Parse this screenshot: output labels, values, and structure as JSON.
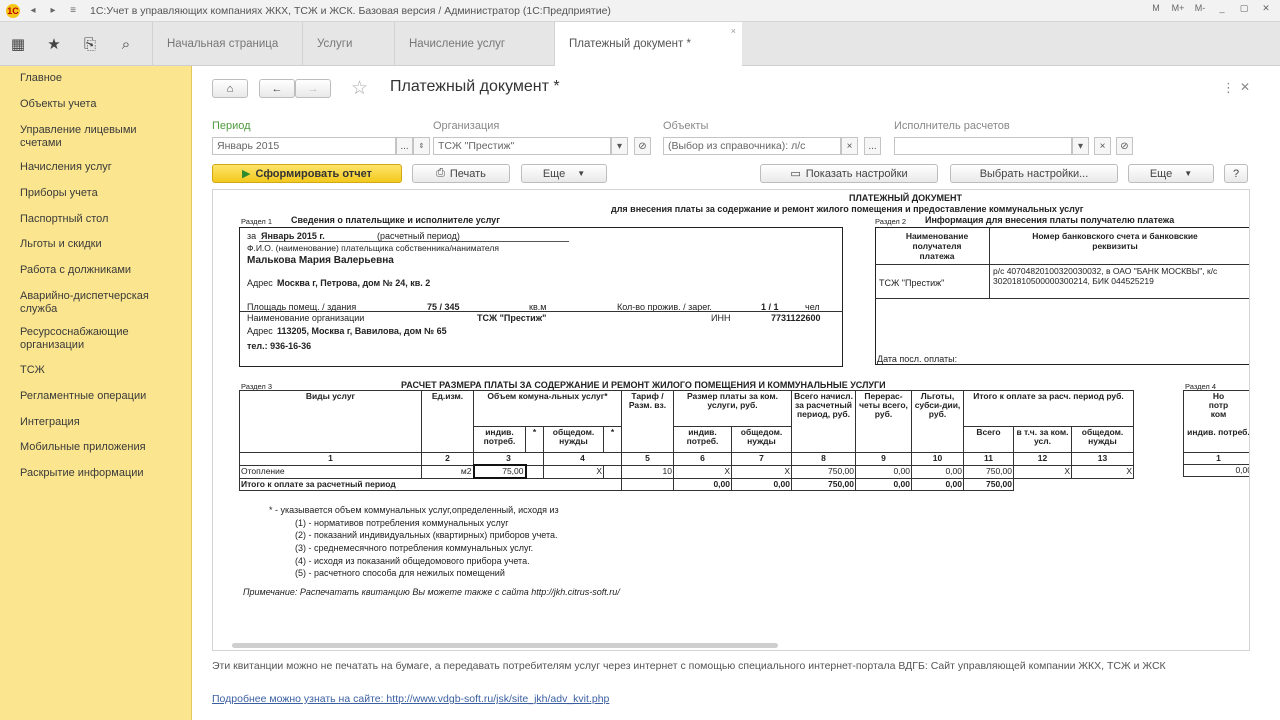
{
  "window": {
    "title": "1С:Учет в управляющих компаниях ЖКХ, ТСЖ и ЖСК. Базовая версия / Администратор  (1С:Предприятие)",
    "right_icons": [
      "M",
      "M+",
      "M-",
      "_",
      "▢",
      "✕"
    ]
  },
  "toolbar_icons": [
    "apps-icon",
    "star-icon",
    "history-icon",
    "search-icon"
  ],
  "tabs": [
    {
      "label": "Начальная страница"
    },
    {
      "label": "Услуги"
    },
    {
      "label": "Начисление услуг"
    },
    {
      "label": "Платежный документ *",
      "close": "×"
    }
  ],
  "sidebar": {
    "items": [
      "Главное",
      "Объекты учета",
      "Управление лицевыми счетами",
      "Начисления услуг",
      "Приборы учета",
      "Паспортный стол",
      "Льготы и скидки",
      "Работа с должниками",
      "Аварийно-диспетчерская служба",
      "Ресурсоснабжающие организации",
      "ТСЖ",
      "Регламентные операции",
      "Интеграция",
      "Мобильные приложения",
      "Раскрытие информации"
    ]
  },
  "form": {
    "title": "Платежный документ *",
    "nav": {
      "home": "⌂",
      "back": "←",
      "forward": "→",
      "star": "☆"
    },
    "corner_icons": [
      "⋮",
      "✕"
    ],
    "period_label": "Период",
    "period_value": "Январь 2015",
    "org_label": "Организация",
    "org_value": "ТСЖ \"Престиж\"",
    "objects_label": "Объекты",
    "objects_value": "(Выбор из справочника): л/с",
    "executor_label": "Исполнитель расчетов",
    "executor_value": "",
    "buttons": {
      "generate": "Сформировать отчет",
      "print": "Печать",
      "more": "Еще",
      "show_settings": "Показать настройки",
      "choose_settings": "Выбрать настройки...",
      "more2": "Еще",
      "help": "?"
    }
  },
  "report": {
    "doc_title": "ПЛАТЕЖНЫЙ ДОКУМЕНТ",
    "doc_subtitle": "для внесения платы за содержание и ремонт жилого помещения и предоставление коммунальных услуг",
    "section1_label": "Раздел 1",
    "section1_title": "Сведения о плательщике и исполнителе услуг",
    "section2_label": "Раздел 2",
    "section2_title": "Информация для внесения платы получателю платежа",
    "for_label": "за",
    "for_period": "Январь 2015 г.",
    "settlement_period": "(расчетный период)",
    "fio_caption": "Ф.И.О. (наименование) плательщика собственника/нанимателя",
    "payer_name": "Малькова Мария Валерьевна",
    "address_label": "Адрес",
    "address_value": "Москва г, Петрова, дом № 24, кв. 2",
    "area_label": "Площадь помещ. / здания",
    "area_value": "75 / 345",
    "area_unit": "кв.м",
    "residents_label": "Кол-во прожив. / зарег.",
    "residents_value": "1 / 1",
    "residents_unit": "чел",
    "org_name_label": "Наименование организации",
    "org_name_value": "ТСЖ \"Престиж\"",
    "inn_label": "ИНН",
    "inn_value": "7731122600",
    "org_address_label": "Адрес",
    "org_address_value": "113205, Москва г, Вавилова, дом № 65",
    "phone_value": "тел.: 936-16-36",
    "recipient_head": "Наименование получателя платежа",
    "bank_head": "Номер банковского счета и банковские реквизиты",
    "recipient_value": "ТСЖ \"Престиж\"",
    "bank_value": "р/с 40704820100320030032, в ОАО \"БАНК МОСКВЫ\", к/с 30201810500000300214, БИК 044525219",
    "last_payment_label": "Дата посл. оплаты:",
    "section3_label": "Раздел 3",
    "section3_title": "РАСЧЕТ РАЗМЕРА ПЛАТЫ ЗА СОДЕРЖАНИЕ И РЕМОНТ ЖИЛОГО ПОМЕЩЕНИЯ И КОММУНАЛЬНЫЕ УСЛУГИ",
    "section4_label": "Раздел 4",
    "table": {
      "h_service": "Виды услуг",
      "h_unit": "Ед.изм.",
      "h_volume": "Объем комуна-льных услуг*",
      "h_tariff": "Тариф / Разм. вз.",
      "h_size": "Размер платы за ком. услуги, руб.",
      "h_total_accrued": "Всего начисл. за расчетный период, руб.",
      "h_recalc": "Перерас-четы всего, руб.",
      "h_benefits": "Льготы, субси-дии, руб.",
      "h_total_pay": "Итого к оплате за расч. период руб.",
      "h_indiv": "индив. потреб.",
      "h_star": "*",
      "h_common": "общедом. нужды",
      "h_total": "Всего",
      "h_incl": "в т.ч. за ком. усл.",
      "h_right_top": "Но",
      "h_right_2": "потр",
      "h_right_3": "ком",
      "col_numbers": [
        "1",
        "2",
        "3",
        "4",
        "5",
        "6",
        "7",
        "8",
        "9",
        "10",
        "11",
        "12",
        "13",
        "1"
      ],
      "row": {
        "service": "Отопление",
        "unit": "м2",
        "volume": "75,00",
        "x": "X",
        "tariff": "10",
        "accrued": "750,00",
        "recalc": "0,00",
        "benefits": "0,00",
        "total": "750,00",
        "right": "0,00"
      },
      "total_row": {
        "label": "Итого к оплате за расчетный период",
        "v1": "0,00",
        "v2": "0,00",
        "v3": "750,00",
        "v4": "0,00",
        "v5": "0,00",
        "v6": "750,00"
      }
    },
    "footnotes": [
      "* - указывается объем коммунальных услуг,определенный, исходя из",
      "(1) - нормативов потребления коммунальных услуг",
      "(2) - показаний индивидуальных (квартирных) приборов учета.",
      "(3) - среднемесячного потребления коммунальных услуг.",
      "(4) - исходя из показаний общедомового прибора учета.",
      "(5) - расчетного способа для нежилых помещений"
    ],
    "note": "Примечание: Распечатать квитанцию Вы можете также с сайта http://jkh.citrus-soft.ru/"
  },
  "bottom_note": "Эти квитанции можно не печатать на бумаге, а передавать потребителям услуг через интернет с помощью специального интернет-портала ВДГБ: Сайт управляющей компании ЖКХ, ТСЖ и ЖСК",
  "bottom_link": "Подробнее можно узнать на сайте: http://www.vdgb-soft.ru/jsk/site_jkh/adv_kvit.php"
}
